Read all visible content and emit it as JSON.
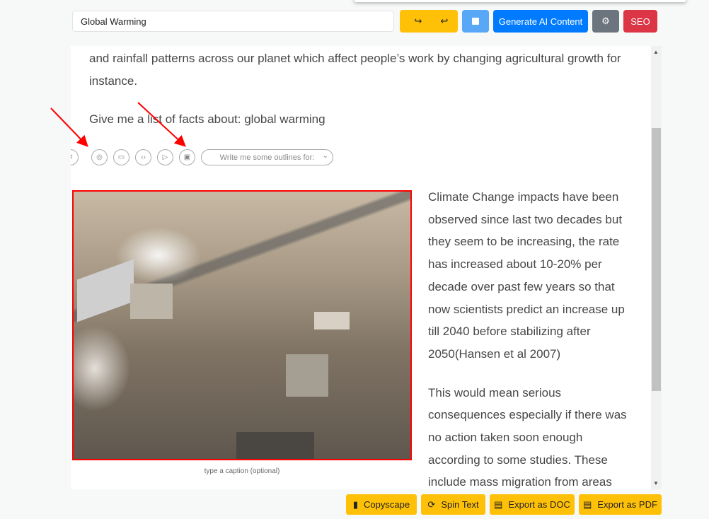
{
  "header": {
    "title_value": "Global Warming",
    "redo_icon": "redo-icon",
    "undo_icon": "undo-icon",
    "save_icon": "save-icon",
    "generate_label": "Generate AI Content",
    "settings_icon": "gear-icon",
    "seo_label": "SEO"
  },
  "colors": {
    "yellow": "#ffc107",
    "light_blue": "#59a8f7",
    "blue": "#007bff",
    "gray": "#6c757d",
    "red": "#dc3545"
  },
  "editor": {
    "para1": "and rainfall patterns across our planet which affect people’s work by changing agricultural growth for instance.",
    "para2": "Give me a list of facts about: global warming",
    "toolbar": {
      "icons": [
        "close-icon",
        "camera-icon",
        "keyboard-icon",
        "code-icon",
        "play-icon",
        "unsplash-camera-icon"
      ],
      "select_value": "Write me some outlines for:"
    },
    "caption_placeholder": "type a caption (optional)",
    "side_paras": [
      "Climate Change impacts have been observed since last two decades but they seem to be increasing, the rate has increased about 10-20% per decade over past few years so that now scientists predict an increase up till 2040 before stabilizing after 2050(Hansen et al 2007)",
      " This would mean serious consequences especially if there was no action taken soon enough according to some studies. These include mass migration from areas"
    ]
  },
  "footer": {
    "copyscape": "Copyscape",
    "spin": "Spin Text",
    "doc": "Export as DOC",
    "pdf": "Export as PDF"
  }
}
